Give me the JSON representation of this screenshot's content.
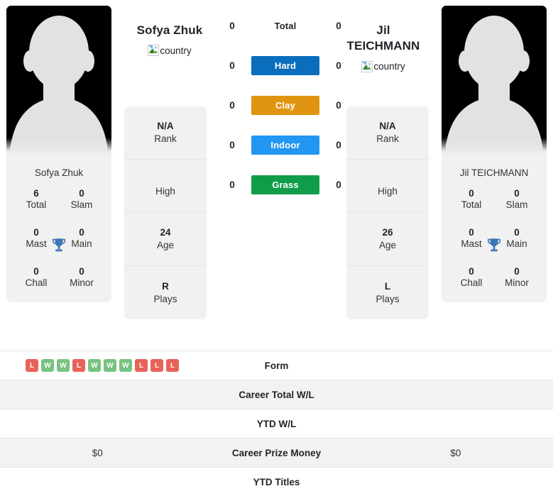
{
  "players": {
    "left": {
      "name": "Sofya Zhuk",
      "photo_caption": "Sofya Zhuk",
      "country_alt": "country",
      "titles": {
        "total_val": "6",
        "total_lab": "Total",
        "slam_val": "0",
        "slam_lab": "Slam",
        "mast_val": "0",
        "mast_lab": "Mast",
        "main_val": "0",
        "main_lab": "Main",
        "chall_val": "0",
        "chall_lab": "Chall",
        "minor_val": "0",
        "minor_lab": "Minor"
      },
      "info": {
        "rank_val": "N/A",
        "rank_lab": "Rank",
        "high_val": "",
        "high_lab": "High",
        "age_val": "24",
        "age_lab": "Age",
        "plays_val": "R",
        "plays_lab": "Plays"
      },
      "surfaces": {
        "total": "0",
        "hard": "0",
        "clay": "0",
        "indoor": "0",
        "grass": "0"
      },
      "form": [
        "L",
        "W",
        "W",
        "L",
        "W",
        "W",
        "W",
        "L",
        "L",
        "L"
      ],
      "career_total_wl": "",
      "ytd_wl": "",
      "career_prize_money": "$0",
      "ytd_titles": ""
    },
    "right": {
      "name": "Jil TEICHMANN",
      "photo_caption": "Jil TEICHMANN",
      "country_alt": "country",
      "titles": {
        "total_val": "0",
        "total_lab": "Total",
        "slam_val": "0",
        "slam_lab": "Slam",
        "mast_val": "0",
        "mast_lab": "Mast",
        "main_val": "0",
        "main_lab": "Main",
        "chall_val": "0",
        "chall_lab": "Chall",
        "minor_val": "0",
        "minor_lab": "Minor"
      },
      "info": {
        "rank_val": "N/A",
        "rank_lab": "Rank",
        "high_val": "",
        "high_lab": "High",
        "age_val": "26",
        "age_lab": "Age",
        "plays_val": "L",
        "plays_lab": "Plays"
      },
      "surfaces": {
        "total": "0",
        "hard": "0",
        "clay": "0",
        "indoor": "0",
        "grass": "0"
      },
      "form": [],
      "career_total_wl": "",
      "ytd_wl": "",
      "career_prize_money": "$0",
      "ytd_titles": ""
    }
  },
  "surface_labels": {
    "total": "Total",
    "hard": "Hard",
    "clay": "Clay",
    "indoor": "Indoor",
    "grass": "Grass"
  },
  "stat_labels": {
    "form": "Form",
    "career_total_wl": "Career Total W/L",
    "ytd_wl": "YTD W/L",
    "career_prize_money": "Career Prize Money",
    "ytd_titles": "YTD Titles"
  },
  "colors": {
    "hard": "#0a6ebd",
    "clay": "#e09510",
    "indoor": "#2196f3",
    "grass": "#0f9d4a",
    "win": "#78c282",
    "loss": "#e8635a",
    "shade": "#f2f2f2",
    "card": "#f1f1f1",
    "trophy": "#3e76b5"
  }
}
